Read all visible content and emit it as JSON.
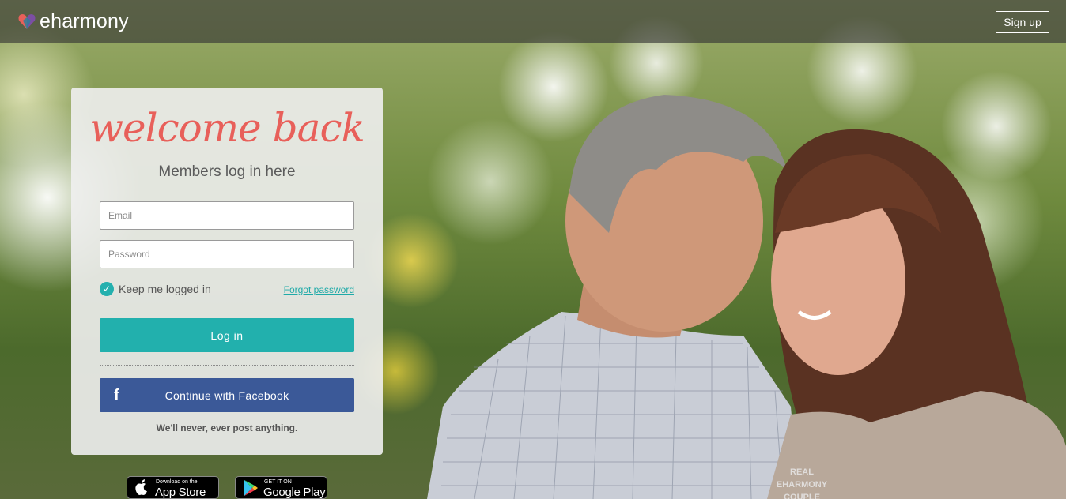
{
  "header": {
    "logo_text": "eharmony",
    "logo_icon": "heart-logo-icon",
    "signup_label": "Sign up"
  },
  "login": {
    "welcome": "welcome back",
    "subtitle": "Members log in here",
    "email_placeholder": "Email",
    "password_placeholder": "Password",
    "keep_logged_in": "Keep me logged in",
    "keep_logged_in_checked": true,
    "forgot_password": "Forgot password",
    "login_label": "Log in",
    "facebook_label": "Continue with Facebook",
    "facebook_icon": "facebook-icon",
    "never_post": "We'll never, ever post anything."
  },
  "badges": {
    "apple_small": "Download on the",
    "apple_big": "App Store",
    "google_small": "GET IT ON",
    "google_big": "Google Play"
  },
  "photo": {
    "caption_lines": [
      "REAL",
      "EHARMONY",
      "COUPLE"
    ]
  },
  "colors": {
    "accent_teal": "#22b0ad",
    "welcome_coral": "#e8605a",
    "facebook_blue": "#3b5998"
  }
}
